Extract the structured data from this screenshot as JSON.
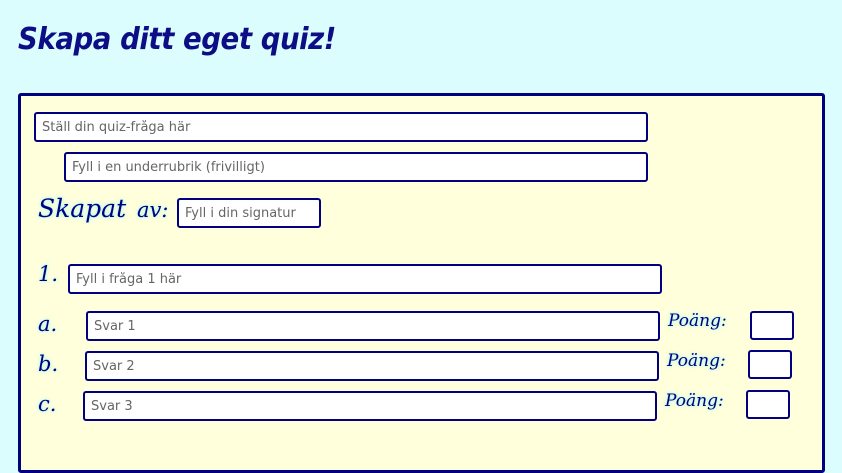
{
  "page_title": "Skapa ditt eget quiz!",
  "quiz_title": {
    "placeholder": "Ställ din quiz-fråga här"
  },
  "subtitle": {
    "placeholder": "Fyll i en underrubrik (frivilligt)"
  },
  "author": {
    "label_created": "Skapat",
    "label_by": "av:",
    "placeholder": "Fyll i din signatur"
  },
  "question": {
    "number": "1.",
    "placeholder": "Fyll i fråga 1 här"
  },
  "answers": [
    {
      "letter": "a.",
      "placeholder": "Svar 1",
      "points_label": "Poäng:"
    },
    {
      "letter": "b.",
      "placeholder": "Svar 2",
      "points_label": "Poäng:"
    },
    {
      "letter": "c.",
      "placeholder": "Svar 3",
      "points_label": "Poäng:"
    }
  ]
}
